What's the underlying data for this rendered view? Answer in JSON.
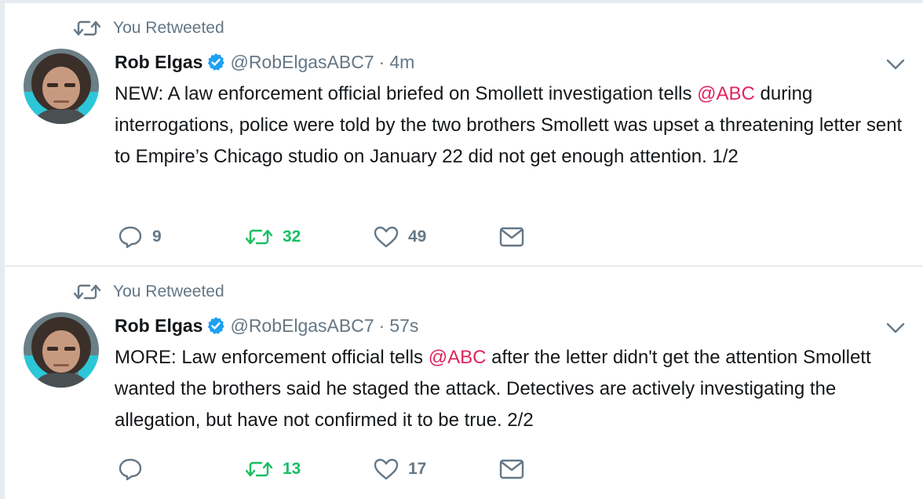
{
  "colors": {
    "mention": "#e0245e",
    "retweet_active": "#17bf63",
    "secondary_text": "#657786",
    "verified": "#1da1f2"
  },
  "tweets": [
    {
      "context_label": "You Retweeted",
      "author_name": "Rob Elgas",
      "handle": "@RobElgasABC7",
      "separator": "·",
      "time": "4m",
      "text_parts": {
        "before": "NEW: A law enforcement official briefed on Smollett investigation tells ",
        "mention": "@ABC",
        "after": " during interrogations, police were told by the two brothers Smollett was upset a threatening letter sent to Empire’s Chicago studio on January 22 did not get enough attention. 1/2"
      },
      "reply_count": "9",
      "retweet_count": "32",
      "like_count": "49"
    },
    {
      "context_label": "You Retweeted",
      "author_name": "Rob Elgas",
      "handle": "@RobElgasABC7",
      "separator": "·",
      "time": "57s",
      "text_parts": {
        "before": "MORE: Law enforcement official tells ",
        "mention": "@ABC",
        "after": " after the letter didn't get the attention Smollett wanted the brothers said he staged the attack. Detectives are actively investigating the allegation, but have not confirmed it to be true. 2/2"
      },
      "reply_count": "",
      "retweet_count": "13",
      "like_count": "17"
    }
  ]
}
